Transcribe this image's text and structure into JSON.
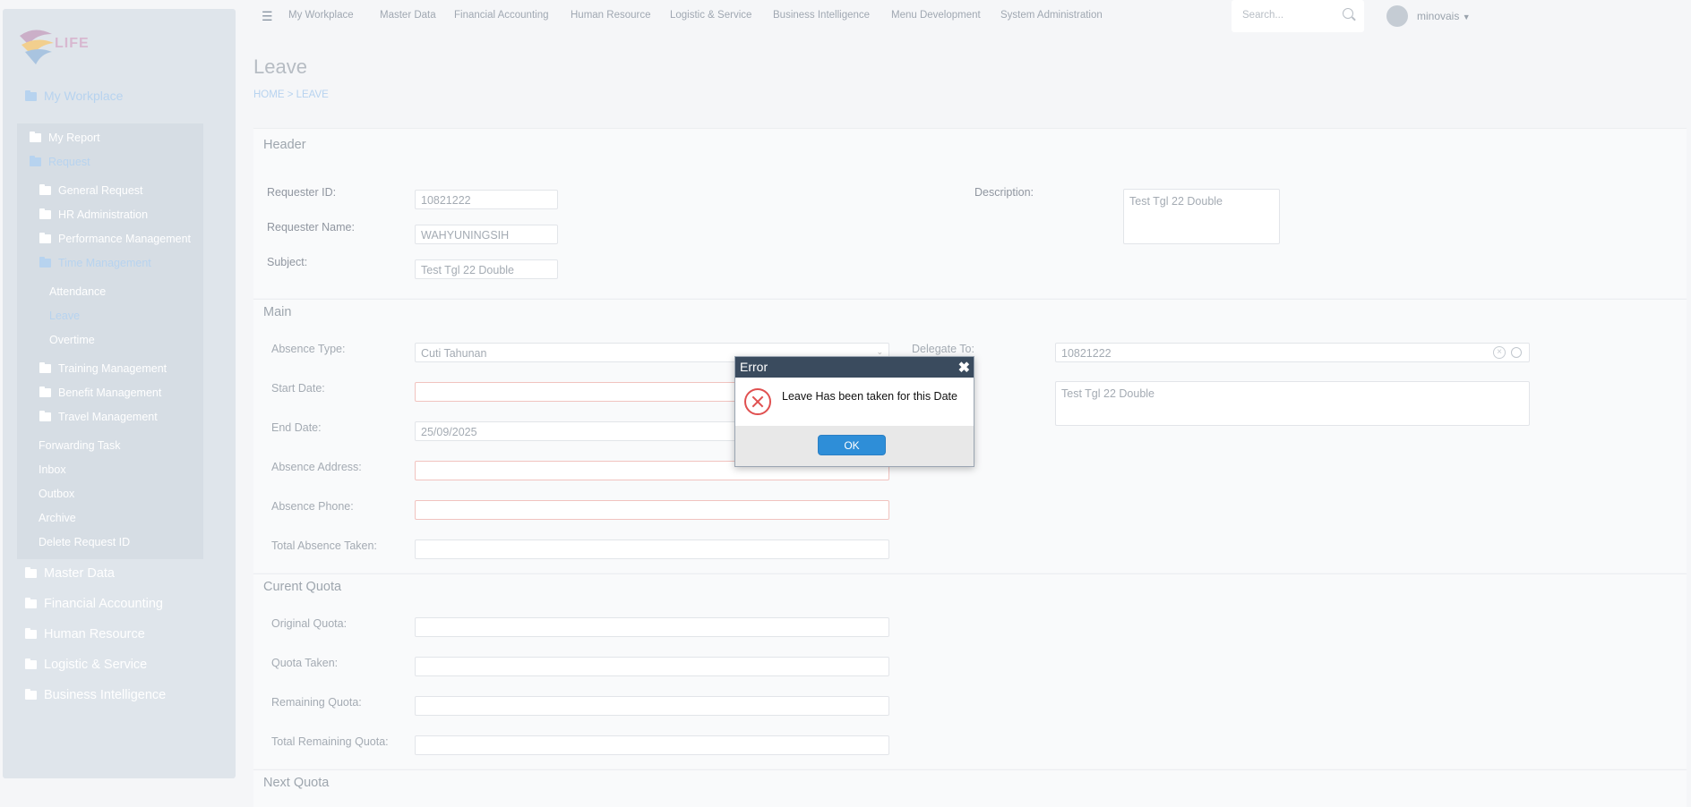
{
  "sidebar": {
    "logo_text_a": "",
    "logo_text_b": "LIFE",
    "top_item": "My Workplace",
    "sub_items": [
      "My Report",
      "Request",
      "General Request",
      "HR Administration",
      "Performance Management",
      "Time Management",
      "Attendance",
      "Leave",
      "Overtime",
      "Training Management",
      "Benefit Management",
      "Travel Management",
      "Forwarding Task",
      "Inbox",
      "Outbox",
      "Archive",
      "Delete Request ID"
    ],
    "bottom_items": [
      "Master Data",
      "Financial Accounting",
      "Human Resource",
      "Logistic & Service",
      "Business Intelligence"
    ]
  },
  "topnav": {
    "items": [
      "My Workplace",
      "Master Data",
      "Financial Accounting",
      "Human Resource",
      "Logistic & Service",
      "Business Intelligence",
      "Menu Development",
      "System Administration"
    ],
    "search_placeholder": "Search...",
    "user": "minovais"
  },
  "page": {
    "title": "Leave",
    "breadcrumb": "HOME  >  LEAVE"
  },
  "header": {
    "title": "Header",
    "requester_id_label": "Requester ID:",
    "requester_id": "10821222",
    "requester_name_label": "Requester Name:",
    "requester_name": "WAHYUNINGSIH",
    "subject_label": "Subject:",
    "subject": "Test Tgl 22 Double",
    "description_label": "Description:",
    "description": "Test Tgl 22 Double"
  },
  "main": {
    "title": "Main",
    "absence_type_label": "Absence Type:",
    "absence_type": "Cuti Tahunan",
    "start_date_label": "Start Date:",
    "start_date": "",
    "end_date_label": "End Date:",
    "end_date": "25/09/2025",
    "absence_address_label": "Absence Address:",
    "absence_phone_label": "Absence Phone:",
    "total_absence_label": "Total Absence Taken:",
    "delegate_label": "Delegate To:",
    "delegate": "10821222",
    "note": "Test Tgl 22 Double"
  },
  "quota": {
    "title": "Curent Quota",
    "original_label": "Original Quota:",
    "taken_label": "Quota Taken:",
    "remaining_label": "Remaining Quota:",
    "total_remaining_label": "Total Remaining Quota:"
  },
  "next_quota": {
    "title": "Next Quota"
  },
  "dialog": {
    "title": "Error",
    "message": "Leave Has been taken for this Date",
    "ok": "OK"
  }
}
